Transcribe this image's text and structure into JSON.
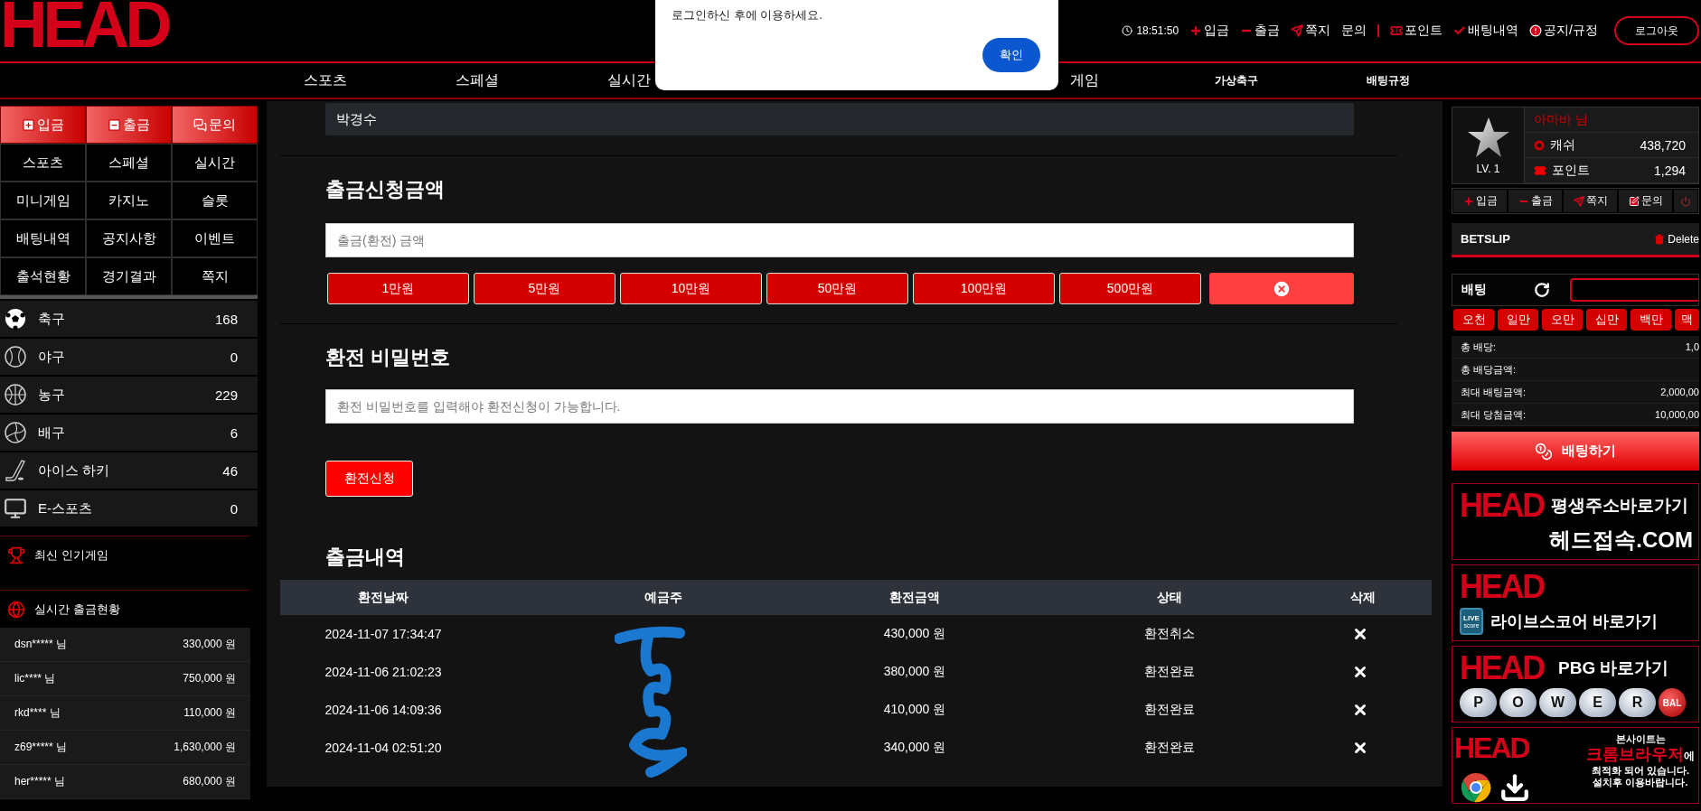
{
  "header": {
    "logo": "HEAD",
    "clock": "18:51:50",
    "links": [
      {
        "label": "입금",
        "kind": "plus",
        "separator_before": false
      },
      {
        "label": "출금",
        "kind": "minus",
        "separator_before": false
      },
      {
        "label": "쪽지",
        "kind": "send",
        "separator_before": false
      },
      {
        "label": "문의",
        "kind": "plain",
        "separator_before": false
      },
      {
        "label": "포인트",
        "kind": "ticket",
        "separator_before": true
      },
      {
        "label": "배팅내역",
        "kind": "check",
        "separator_before": false
      },
      {
        "label": "공지/규정",
        "kind": "alert",
        "separator_before": false
      }
    ],
    "logout": "로그아웃"
  },
  "nav": [
    {
      "label": "스포츠",
      "kind": "main"
    },
    {
      "label": "스페셜",
      "kind": "main"
    },
    {
      "label": "실시간",
      "kind": "main"
    },
    {
      "label": "게임",
      "kind": "main"
    },
    {
      "label": "가상축구",
      "kind": "small"
    },
    {
      "label": "배팅규정",
      "kind": "small"
    }
  ],
  "dialog": {
    "message": "로그인하신 후에 이용하세요.",
    "button": "확인"
  },
  "sidebar": {
    "actions": [
      {
        "label": "입금",
        "kind": "plus"
      },
      {
        "label": "출금",
        "kind": "minus"
      },
      {
        "label": "문의",
        "kind": "chat"
      }
    ],
    "menu": [
      "스포츠",
      "스페셜",
      "실시간",
      "미니게임",
      "카지노",
      "슬롯",
      "배팅내역",
      "공지사항",
      "이벤트",
      "출석현황",
      "경기결과",
      "쪽지"
    ],
    "sports": [
      {
        "name": "축구",
        "count": "168",
        "kind": "soccer"
      },
      {
        "name": "야구",
        "count": "0",
        "kind": "baseball"
      },
      {
        "name": "농구",
        "count": "229",
        "kind": "basketball"
      },
      {
        "name": "배구",
        "count": "6",
        "kind": "volleyball"
      },
      {
        "name": "아이스 하키",
        "count": "46",
        "kind": "hockey"
      },
      {
        "name": "E-스포츠",
        "count": "0",
        "kind": "esports"
      }
    ],
    "popular_title": "최신 인기게임",
    "withdraw_title": "실시간 출금현황",
    "withdrawals": [
      {
        "user": "dsn***** 님",
        "amount": "330,000 원"
      },
      {
        "user": "lic**** 님",
        "amount": "750,000 원"
      },
      {
        "user": "rkd**** 님",
        "amount": "110,000 원"
      },
      {
        "user": "z69***** 님",
        "amount": "1,630,000 원"
      },
      {
        "user": "her***** 님",
        "amount": "680,000 원"
      }
    ]
  },
  "main": {
    "holder": "박경수",
    "amount_title": "출금신청금액",
    "amount_placeholder": "출금(환전) 금액",
    "quick_amounts": [
      "1만원",
      "5만원",
      "10만원",
      "50만원",
      "100만원",
      "500만원"
    ],
    "password_title": "환전 비밀번호",
    "password_placeholder": "환전 비밀번호를 입력해야 환전신청이 가능합니다.",
    "submit": "환전신청",
    "history_title": "출금내역",
    "table": {
      "columns": [
        "환전날짜",
        "예금주",
        "환전금액",
        "상태",
        "삭제"
      ],
      "rows": [
        {
          "date": "2024-11-07 17:34:47",
          "amount": "430,000 원",
          "status": "환전취소"
        },
        {
          "date": "2024-11-06 21:02:23",
          "amount": "380,000 원",
          "status": "환전완료"
        },
        {
          "date": "2024-11-06 14:09:36",
          "amount": "410,000 원",
          "status": "환전완료"
        },
        {
          "date": "2024-11-04 02:51:20",
          "amount": "340,000 원",
          "status": "환전완료"
        }
      ]
    }
  },
  "profile": {
    "name": "아마바 님",
    "level": "LV. 1",
    "cash_label": "캐쉬",
    "cash": "438,720",
    "point_label": "포인트",
    "point": "1,294",
    "actions": [
      {
        "label": "입금",
        "kind": "plus"
      },
      {
        "label": "출금",
        "kind": "minus"
      },
      {
        "label": "쪽지",
        "kind": "send"
      },
      {
        "label": "문의",
        "kind": "edit"
      },
      {
        "kind": "power"
      }
    ]
  },
  "betslip": {
    "title": "BETSLIP",
    "delete": "Delete",
    "bet_label": "배팅",
    "chips": [
      "오천",
      "일만",
      "오만",
      "십만",
      "백만",
      "맥"
    ],
    "summary": [
      {
        "label": "총 배당:",
        "value": "1,0"
      },
      {
        "label": "총 배당금액:"
      },
      {
        "label": "최대 배팅금액:",
        "value": "2,000,00"
      },
      {
        "label": "최대 당첨금액:",
        "value": "10,000,00"
      }
    ],
    "submit": "배팅하기"
  },
  "banners": [
    {
      "kind": "address",
      "logo": "HEAD",
      "title": "평생주소바로가기",
      "subtitle": "헤드접속.COM"
    },
    {
      "kind": "livescore",
      "logo": "HEAD",
      "badge_top": "LIVE",
      "badge_bottom": "score",
      "title": "라이브스코어 바로가기"
    },
    {
      "kind": "powerball",
      "logo": "HEAD",
      "title": "PBG 바로가기",
      "balls": [
        "P",
        "O",
        "W",
        "E",
        "R",
        "BAL"
      ]
    },
    {
      "kind": "chrome",
      "logo": "HEAD",
      "lines": [
        "본사이트는",
        "최적화 되어 있습니다.",
        "설치후 이용바랍니다."
      ],
      "accent": "크롬브라우저",
      "accent_suffix": "에"
    }
  ]
}
